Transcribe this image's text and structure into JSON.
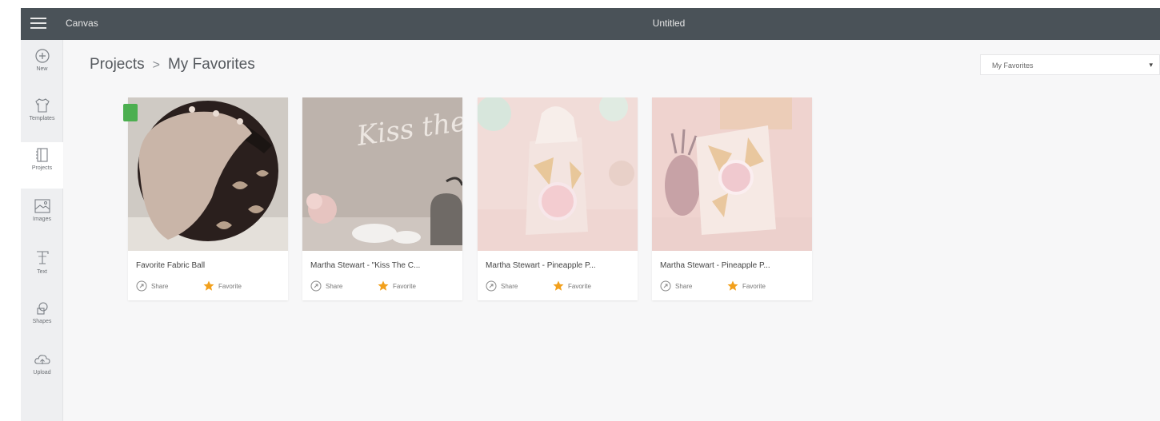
{
  "topbar": {
    "app_name": "Canvas",
    "doc_title": "Untitled"
  },
  "sidebar": {
    "items": [
      {
        "label": "New",
        "icon": "plus-circle-icon"
      },
      {
        "label": "Templates",
        "icon": "shirt-icon"
      },
      {
        "label": "Projects",
        "icon": "notebook-icon",
        "active": true
      },
      {
        "label": "Images",
        "icon": "image-icon"
      },
      {
        "label": "Text",
        "icon": "text-icon"
      },
      {
        "label": "Shapes",
        "icon": "shapes-icon"
      },
      {
        "label": "Upload",
        "icon": "upload-icon"
      }
    ]
  },
  "main": {
    "breadcrumb": {
      "parent": "Projects",
      "separator": ">",
      "current": "My Favorites"
    },
    "filter": {
      "selected": "My Favorites"
    }
  },
  "cards": [
    {
      "title": "Favorite Fabric Ball",
      "share": "Share",
      "favorite": "Favorite"
    },
    {
      "title": "Martha Stewart - \"Kiss The C...",
      "share": "Share",
      "favorite": "Favorite",
      "image_text": "Kiss the cook"
    },
    {
      "title": "Martha Stewart - Pineapple P...",
      "share": "Share",
      "favorite": "Favorite"
    },
    {
      "title": "Martha Stewart - Pineapple P...",
      "share": "Share",
      "favorite": "Favorite"
    }
  ],
  "colors": {
    "topbar": "#4a5258",
    "favorite_star": "#f2a01c",
    "badge": "#4caf50"
  }
}
